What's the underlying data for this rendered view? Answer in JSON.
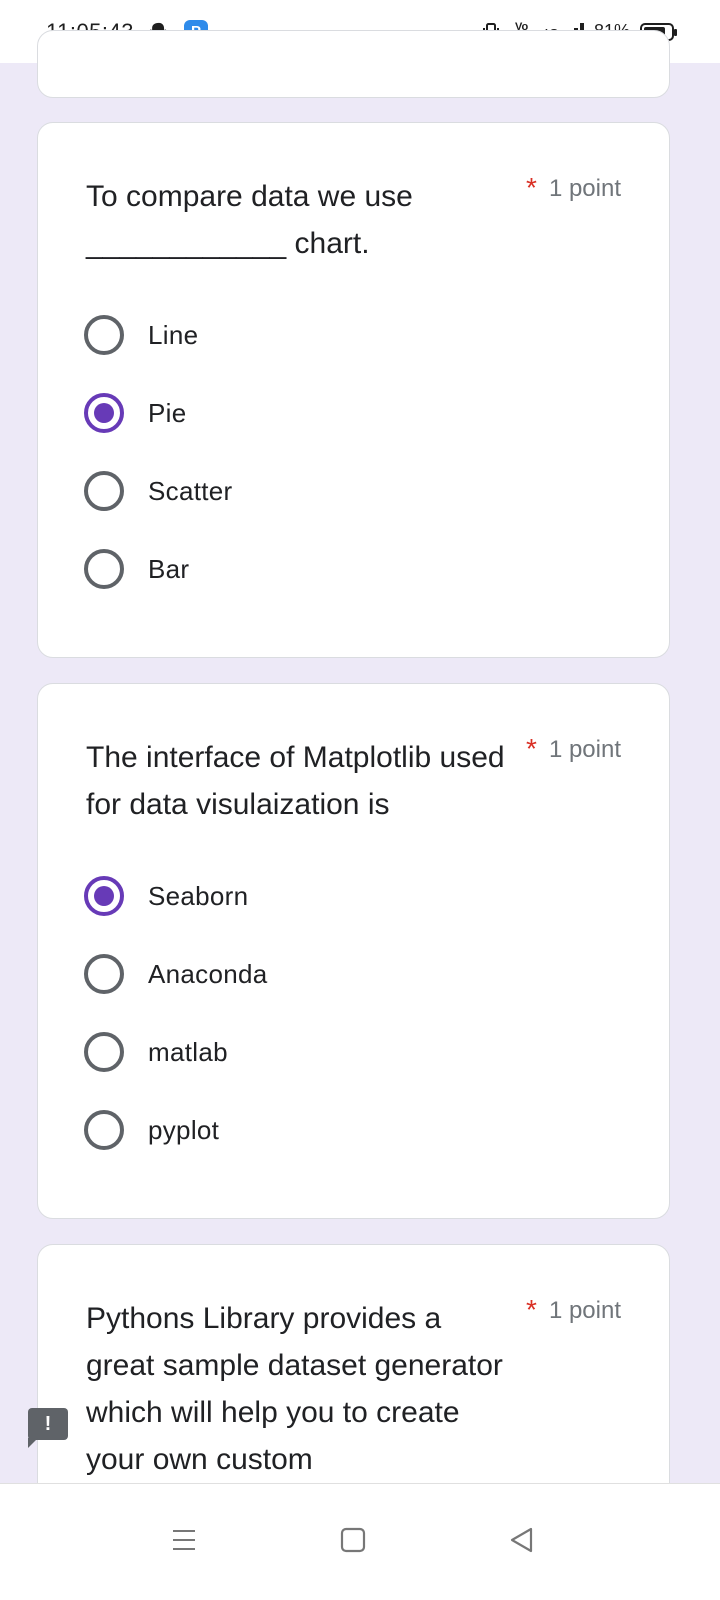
{
  "status_bar": {
    "time": "11:05:43",
    "battery": "81%",
    "network": "4G",
    "volte": "Vo LTE",
    "app_badge": "P"
  },
  "questions": [
    {
      "title": "To compare data we use ____________ chart.",
      "points": "1 point",
      "required_mark": "*",
      "options": [
        {
          "label": "Line",
          "selected": false
        },
        {
          "label": "Pie",
          "selected": true
        },
        {
          "label": "Scatter",
          "selected": false
        },
        {
          "label": "Bar",
          "selected": false
        }
      ]
    },
    {
      "title": "The interface of Matplotlib used for data visulaization is",
      "points": "1 point",
      "required_mark": "*",
      "options": [
        {
          "label": "Seaborn",
          "selected": true
        },
        {
          "label": "Anaconda",
          "selected": false
        },
        {
          "label": "matlab",
          "selected": false
        },
        {
          "label": "pyplot",
          "selected": false
        }
      ]
    },
    {
      "title": "Pythons Library provides a great sample dataset generator which will help you to create your own custom",
      "points": "1 point",
      "required_mark": "*",
      "options": []
    }
  ],
  "feedback_icon": "!",
  "colors": {
    "accent": "#673ab7",
    "required": "#d93025",
    "background": "#ede9f7"
  }
}
